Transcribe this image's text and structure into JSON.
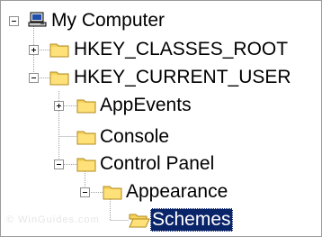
{
  "tree": {
    "root": {
      "label": "My Computer",
      "icon": "computer-icon",
      "expanded": true
    },
    "items": [
      {
        "label": "HKEY_CLASSES_ROOT",
        "icon": "folder-icon",
        "expanded": false
      },
      {
        "label": "HKEY_CURRENT_USER",
        "icon": "folder-icon",
        "expanded": true
      },
      {
        "label": "AppEvents",
        "icon": "folder-icon",
        "expanded": false
      },
      {
        "label": "Console",
        "icon": "folder-icon"
      },
      {
        "label": "Control Panel",
        "icon": "folder-icon",
        "expanded": true
      },
      {
        "label": "Appearance",
        "icon": "folder-icon",
        "expanded": true
      },
      {
        "label": "Schemes",
        "icon": "open-folder-icon",
        "selected": true
      }
    ]
  },
  "watermark": "© WinGuides.com",
  "colors": {
    "selection": "#0a246a",
    "folder": "#f5d35b",
    "folder_edge": "#b08a1c",
    "connector": "#a0a0a0"
  }
}
